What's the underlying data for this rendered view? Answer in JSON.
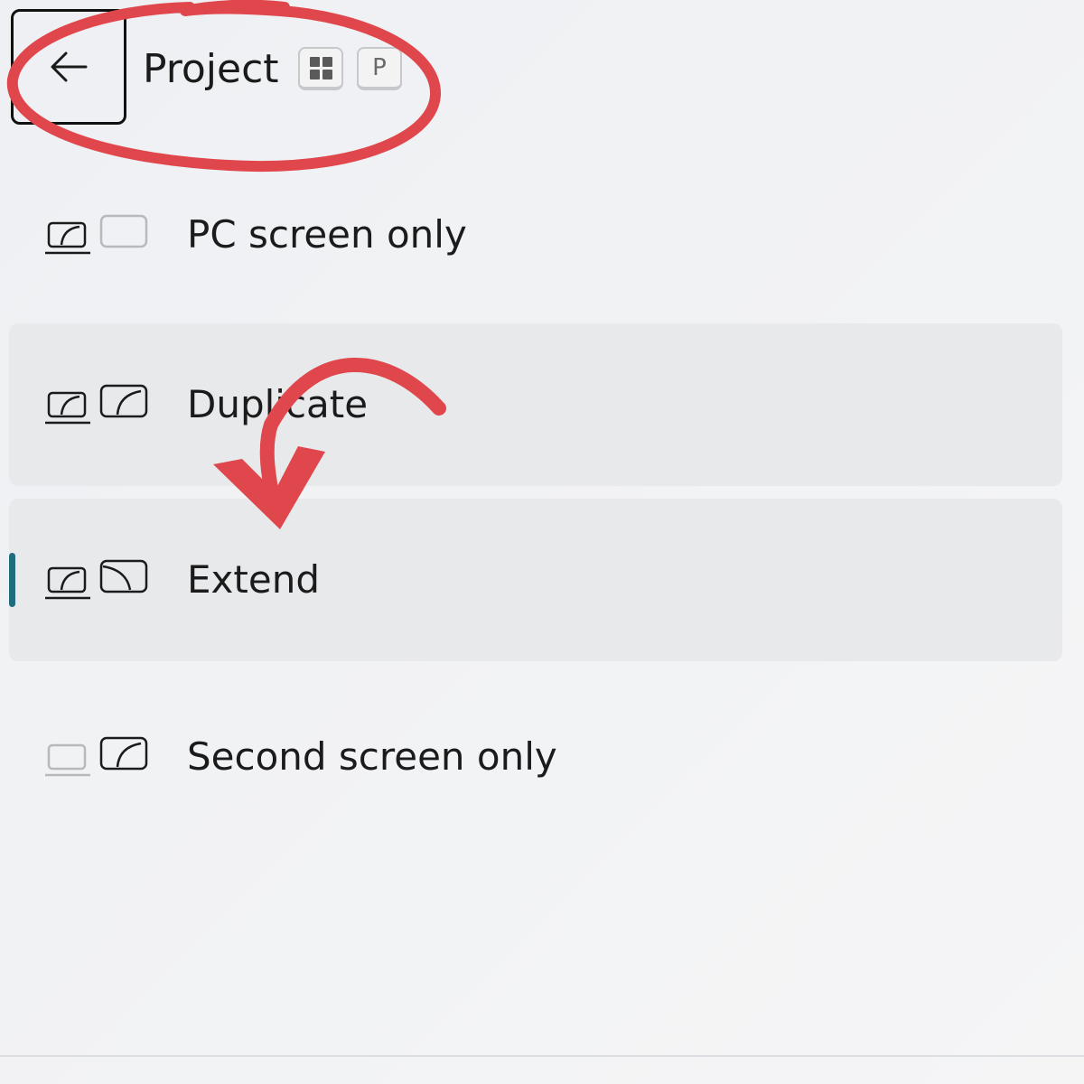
{
  "header": {
    "title": "Project",
    "shortcut_key_p": "P",
    "shortcut_key_win_icon": "windows-logo-icon",
    "back_icon": "arrow-left-icon"
  },
  "options": [
    {
      "label": "PC screen only",
      "icon": "pc-screen-only-icon",
      "highlighted": false,
      "selected": false
    },
    {
      "label": "Duplicate",
      "icon": "duplicate-icon",
      "highlighted": true,
      "selected": false
    },
    {
      "label": "Extend",
      "icon": "extend-icon",
      "highlighted": true,
      "selected": true
    },
    {
      "label": "Second screen only",
      "icon": "second-screen-only-icon",
      "highlighted": false,
      "selected": false
    }
  ],
  "colors": {
    "background": "#f1f2f4",
    "highlight": "#e8e9eb",
    "selected_indicator": "#1f6c7f",
    "annotation": "#e0474c",
    "text": "#1b1b1b"
  },
  "annotations": {
    "circle": "red-circle-annotation",
    "arrow": "red-curved-arrow-annotation"
  }
}
